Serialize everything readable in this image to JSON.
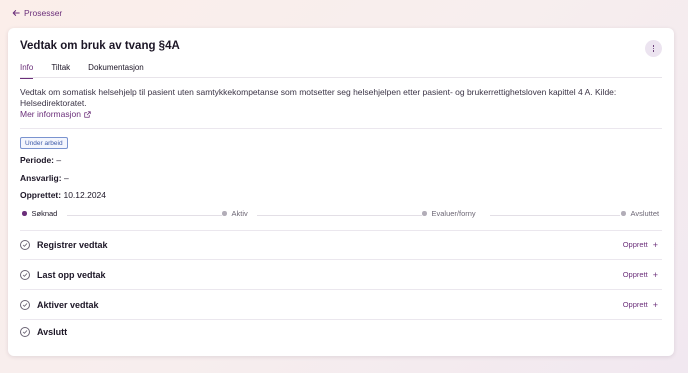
{
  "nav": {
    "back_label": "Prosesser"
  },
  "page": {
    "title": "Vedtak om bruk av tvang §4A"
  },
  "tabs": [
    {
      "label": "Info",
      "active": true
    },
    {
      "label": "Tiltak",
      "active": false
    },
    {
      "label": "Dokumentasjon",
      "active": false
    }
  ],
  "info": {
    "description": "Vedtak om somatisk helsehjelp til pasient uten samtykkekompetanse som motsetter seg helsehjelpen etter pasient- og brukerrettighetsloven kapittel 4 A. Kilde: Helsedirektoratet.",
    "more_link": "Mer informasjon",
    "status_badge": "Under arbeid",
    "periode_label": "Periode:",
    "periode_value": "–",
    "ansvarlig_label": "Ansvarlig:",
    "ansvarlig_value": "–",
    "opprettet_label": "Opprettet:",
    "opprettet_value": "10.12.2024"
  },
  "steps": [
    {
      "label": "Søknad",
      "active": true
    },
    {
      "label": "Aktiv",
      "active": false
    },
    {
      "label": "Evaluer/forny",
      "active": false
    },
    {
      "label": "Avsluttet",
      "active": false
    }
  ],
  "tasks": [
    {
      "name": "Registrer vedtak",
      "action": "Opprett"
    },
    {
      "name": "Last opp vedtak",
      "action": "Opprett"
    },
    {
      "name": "Aktiver vedtak",
      "action": "Opprett"
    },
    {
      "name": "Avslutt",
      "action": ""
    }
  ],
  "colors": {
    "accent": "#6b2f7a",
    "badge": "#3d5aa8"
  }
}
